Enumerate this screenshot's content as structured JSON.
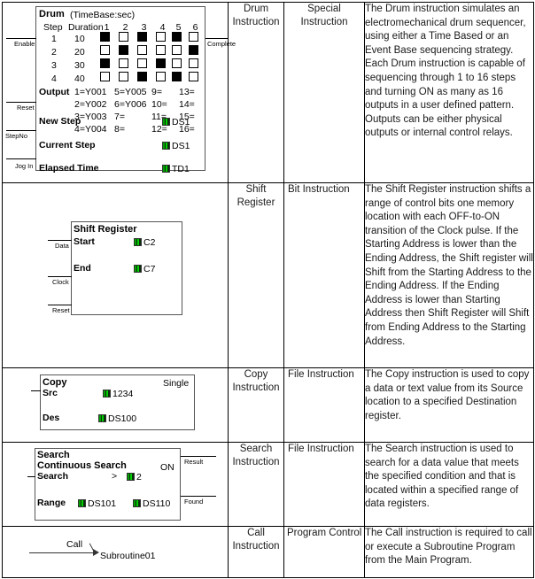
{
  "table": {
    "rows": [
      {
        "name": "Drum\nInstruction",
        "name_l1": "Drum",
        "name_l2": "Instruction",
        "type": "Special Instruction",
        "type_l1": "Special",
        "type_l2": "Instruction",
        "description": "The Drum instruction simulates an electromechanical drum sequencer, using either a Time Based or an Event Base sequencing strategy. Each Drum instruction is capable of sequencing through 1 to 16 steps and turning ON as many as 16 outputs in a user defined pattern. Outputs can be either physical outputs or internal control relays.",
        "diagram": {
          "title": "Drum",
          "title_suffix": "(TimeBase:sec)",
          "col_step": "Step",
          "col_duration": "Duration",
          "step_columns": [
            "1",
            "2",
            "3",
            "4",
            "5",
            "6"
          ],
          "steps": [
            {
              "step": "1",
              "duration": "10",
              "cells": [
                1,
                0,
                1,
                0,
                1,
                0
              ]
            },
            {
              "step": "2",
              "duration": "20",
              "cells": [
                0,
                1,
                0,
                0,
                0,
                1
              ]
            },
            {
              "step": "3",
              "duration": "30",
              "cells": [
                1,
                0,
                0,
                1,
                0,
                0
              ]
            },
            {
              "step": "4",
              "duration": "40",
              "cells": [
                0,
                0,
                1,
                0,
                1,
                0
              ]
            }
          ],
          "output_label": "Output",
          "outputs_c1": [
            "1=Y001",
            "2=Y002",
            "3=Y003",
            "4=Y004"
          ],
          "outputs_c2": [
            "5=Y005",
            "6=Y006",
            "7=",
            "8="
          ],
          "outputs_c3": [
            "9=",
            "10=",
            "11=",
            "12="
          ],
          "outputs_c4": [
            "13=",
            "14=",
            "15=",
            "16="
          ],
          "fields": [
            {
              "label": "New Step",
              "value": "DS1"
            },
            {
              "label": "Current Step",
              "value": "DS1"
            },
            {
              "label": "Elapsed Time",
              "value": "TD1"
            }
          ],
          "pins_left": [
            "Enable",
            "Reset",
            "StepNo",
            "Jog In"
          ],
          "pins_right": [
            "Complete"
          ]
        }
      },
      {
        "name": "Shift Register",
        "name_l1": "Shift",
        "name_l2": "Register",
        "type": "Bit Instruction",
        "type_l1": "Bit Instruction",
        "type_l2": "",
        "description": "The Shift Register instruction shifts a range of control bits one memory location with each OFF-to-ON transition of the Clock pulse. If the Starting Address is lower than the Ending Address, the Shift register will Shift from the Starting Address to the Ending Address.  If the Ending Address is lower than Starting Address then Shift Register will Shift from Ending Address to the Starting Address.",
        "diagram": {
          "title": "Shift Register",
          "fields": [
            {
              "label": "Start",
              "value": "C2"
            },
            {
              "label": "End",
              "value": "C7"
            }
          ],
          "pins_left": [
            "Data",
            "Clock",
            "Reset"
          ]
        }
      },
      {
        "name": "Copy Instruction",
        "name_l1": "Copy",
        "name_l2": "Instruction",
        "type": "File Instruction",
        "type_l1": "File Instruction",
        "type_l2": "",
        "description": "The Copy instruction is used to copy a data or text value from its Source location to a specified Destination register.",
        "diagram": {
          "title": "Copy",
          "corner_label": "Single",
          "fields": [
            {
              "label": "Src",
              "value": "1234"
            },
            {
              "label": "Des",
              "value": "DS100"
            }
          ]
        }
      },
      {
        "name": "Search Instruction",
        "name_l1": "Search",
        "name_l2": "Instruction",
        "type": "File Instruction",
        "type_l1": "File Instruction",
        "type_l2": "",
        "description": "The Search instruction is used to search for a data value that meets the specified condition and that is located within a specified range of data registers.",
        "diagram": {
          "title": "Search",
          "subtitle": "Continuous Search",
          "state": "ON",
          "search_label": "Search",
          "operator": ">",
          "search_value": "2",
          "range_label": "Range",
          "range_from": "DS101",
          "range_to": "DS110",
          "pins_right": [
            "Result",
            "Found"
          ]
        }
      },
      {
        "name": "Call Instruction",
        "name_l1": "Call",
        "name_l2": "Instruction",
        "type": "Program Control",
        "type_l1": "Program Control",
        "type_l2": "",
        "description": "The Call instruction is required to call or execute a Subroutine Program from the Main Program.",
        "diagram": {
          "call_label": "Call",
          "target": "Subroutine01"
        }
      }
    ]
  },
  "colors": {
    "tag_green": "#00c000",
    "border": "#000000",
    "text": "#1a1a1a"
  }
}
